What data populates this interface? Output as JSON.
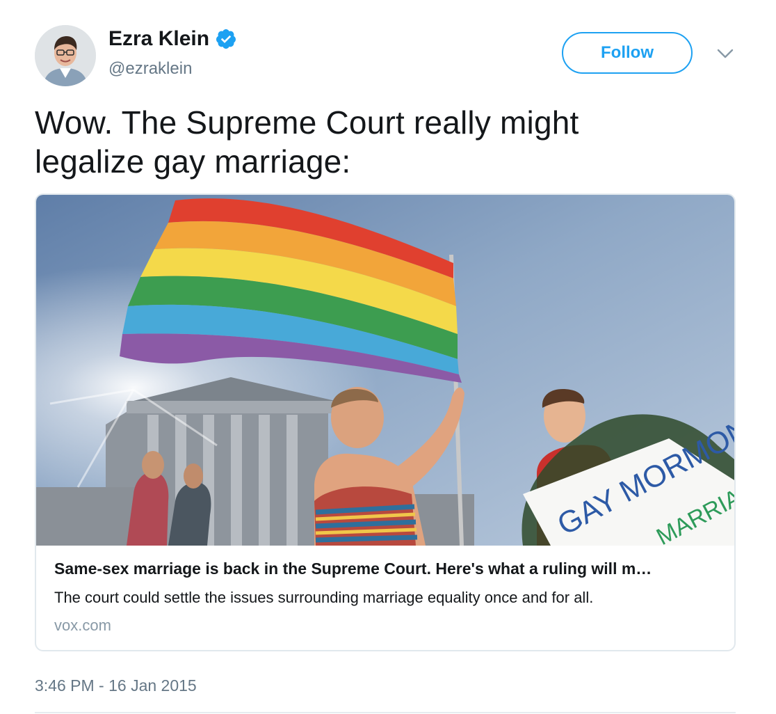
{
  "author": {
    "display_name": "Ezra Klein",
    "handle": "@ezraklein",
    "verified": true,
    "avatar_icon": "person-avatar"
  },
  "actions": {
    "follow_label": "Follow",
    "menu_icon": "chevron-down-icon"
  },
  "tweet": {
    "text_line1": "Wow. The Supreme Court really might",
    "text_line2": "legalize gay marriage:",
    "timestamp": "3:46 PM - 16 Jan 2015"
  },
  "card": {
    "image_alt": "photo-rainbow-flag-supreme-court",
    "sign_text_line1": "GAY MORMON",
    "sign_text_line2": "MARRIAGE",
    "title": "Same-sex marriage is back in the Supreme Court. Here's what a ruling will m…",
    "description": "The court could settle the issues surrounding marriage equality once and for all.",
    "domain": "vox.com"
  },
  "colors": {
    "accent": "#1da1f2",
    "text": "#14171a",
    "secondary": "#657786",
    "border": "#e1e8ed"
  }
}
